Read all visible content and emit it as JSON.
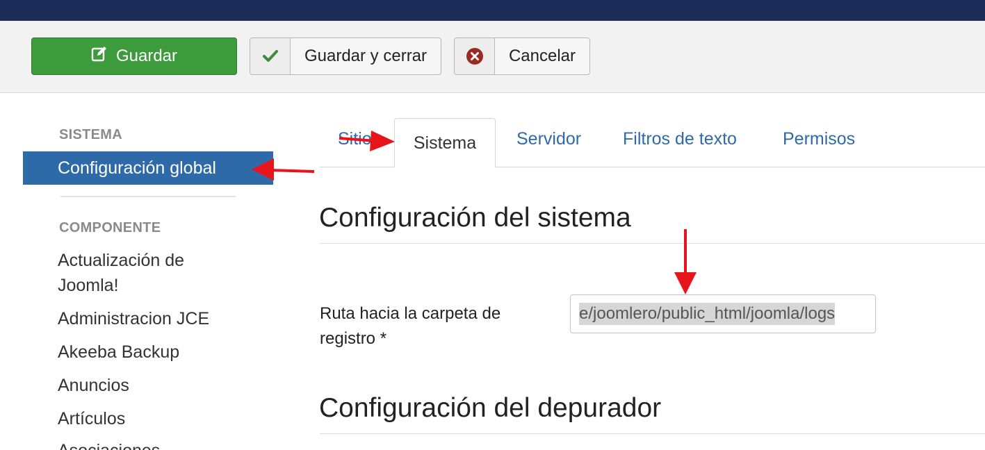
{
  "toolbar": {
    "save_label": "Guardar",
    "save_close_label": "Guardar y cerrar",
    "cancel_label": "Cancelar"
  },
  "sidebar": {
    "system_heading": "SISTEMA",
    "active_item": "Configuración global",
    "component_heading": "COMPONENTE",
    "items": [
      "Actualización de",
      "Joomla!",
      "Administracion JCE",
      "Akeeba Backup",
      "Anuncios",
      "Artículos",
      "Asociaciones"
    ]
  },
  "tabs": {
    "site": "Sitio",
    "system": "Sistema",
    "server": "Servidor",
    "text_filters": "Filtros de texto",
    "permissions": "Permisos"
  },
  "content": {
    "system_config_title": "Configuración del sistema",
    "log_path_label_line1": "Ruta hacia la carpeta de",
    "log_path_label_line2": "registro *",
    "log_path_value": "e/joomlero/public_html/joomla/logs",
    "debug_config_title": "Configuración del depurador"
  },
  "colors": {
    "topbar": "#1a2c57",
    "save_green": "#3c9c3c",
    "active_blue": "#2f6aa8",
    "annotation_red": "#e8141c"
  }
}
